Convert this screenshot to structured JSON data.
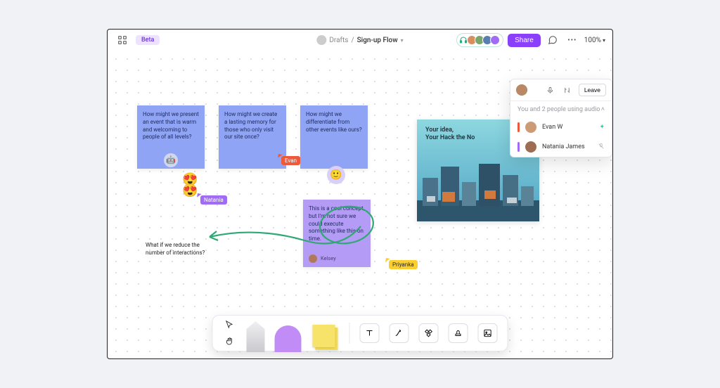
{
  "topbar": {
    "beta_label": "Beta",
    "breadcrumb_folder": "Drafts",
    "breadcrumb_sep": "/",
    "breadcrumb_doc": "Sign-up Flow",
    "share_label": "Share",
    "zoom_label": "100%"
  },
  "canvas": {
    "sticky1": "How might we present an event that is warm and welcoming to people of all levels?",
    "sticky2": "How might we create a lasting memory for those who only visit our site once?",
    "sticky3": "How might we differentiate from other events like ours?",
    "plaintext": "What if we reduce the number of interactions?",
    "sticky4": "This is a cool concept, but I'm not sure we could execute something like this on time.",
    "sticky4_author": "Kelsey",
    "cursor_evan": "Evan",
    "cursor_natania": "Natania",
    "cursor_priyanka": "Priyanka",
    "image_line1": "Your idea,",
    "image_line2": "Your Hack the No"
  },
  "audio": {
    "leave_label": "Leave",
    "summary": "You and 2 people using audio",
    "p1_name": "Evan W",
    "p2_name": "Natania James"
  },
  "colors": {
    "accent": "#8a3ffc",
    "evan": "#ec5a3b",
    "natania": "#a06cf5",
    "priyanka": "#fbcf2f"
  }
}
